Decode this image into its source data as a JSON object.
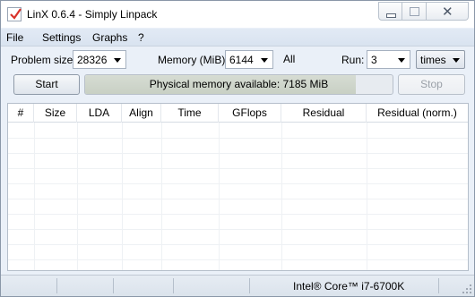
{
  "window": {
    "title": "LinX 0.6.4 - Simply Linpack"
  },
  "menu": {
    "items": [
      "File",
      "Settings",
      "Graphs",
      "?"
    ]
  },
  "controls": {
    "problem_size_label": "Problem size:",
    "problem_size_value": "28326",
    "memory_label": "Memory (MiB):",
    "memory_value": "6144",
    "all_label": "All",
    "run_label": "Run:",
    "run_value": "3",
    "times_value": "times"
  },
  "actions": {
    "start_label": "Start",
    "stop_label": "Stop",
    "progress_text": "Physical memory available: 7185 MiB",
    "progress_fraction": 0.88
  },
  "table": {
    "columns": [
      "#",
      "Size",
      "LDA",
      "Align",
      "Time",
      "GFlops",
      "Residual",
      "Residual (norm.)"
    ],
    "rows": []
  },
  "statusbar": {
    "cpu": "Intel® Core™ i7-6700K"
  },
  "icons": [
    "app-check-icon",
    "minimize-icon",
    "maximize-icon",
    "close-icon",
    "chevron-down-icon",
    "resize-grip-icon"
  ]
}
